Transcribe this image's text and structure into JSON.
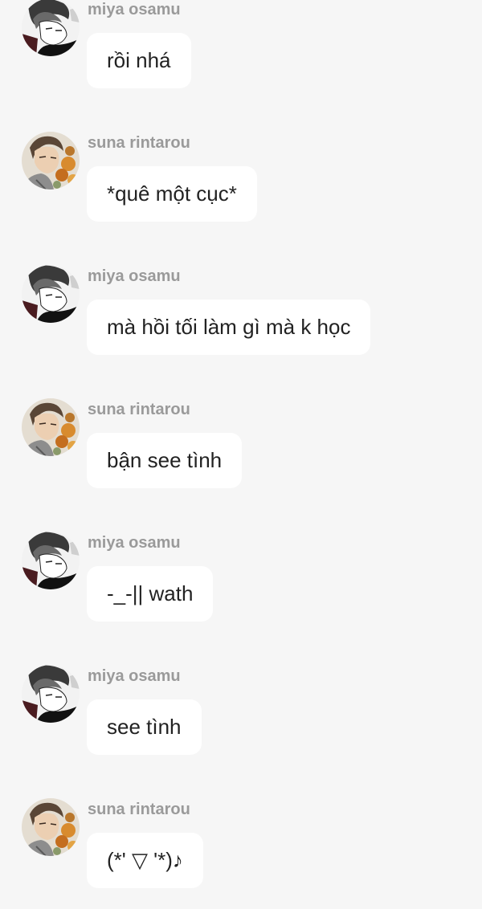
{
  "messages": [
    {
      "sender": "miya osamu",
      "avatar": "osamu-avatar",
      "text": "rồi nhá"
    },
    {
      "sender": "suna rintarou",
      "avatar": "suna-avatar",
      "text": "*quê một cục*"
    },
    {
      "sender": "miya osamu",
      "avatar": "osamu-avatar",
      "text": "mà hồi tối làm gì mà k học"
    },
    {
      "sender": "suna rintarou",
      "avatar": "suna-avatar",
      "text": "bận see tình"
    },
    {
      "sender": "miya osamu",
      "avatar": "osamu-avatar",
      "text": "-_-|| wath"
    },
    {
      "sender": "miya osamu",
      "avatar": "osamu-avatar",
      "text": "see tình"
    },
    {
      "sender": "suna rintarou",
      "avatar": "suna-avatar",
      "text": "(*' ▽ '*)♪"
    }
  ],
  "colors": {
    "background": "#f6f6f6",
    "bubble": "#ffffff",
    "sender_name": "#9a9a9a",
    "message_text": "#222222"
  }
}
